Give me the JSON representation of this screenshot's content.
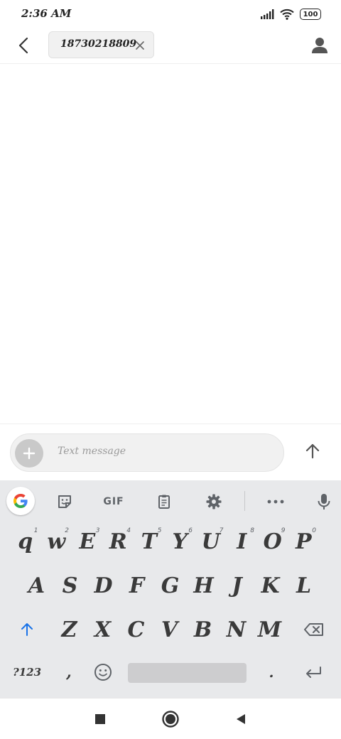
{
  "status_bar": {
    "time": "2:36 AM",
    "battery": "100",
    "icons": [
      "signal-icon",
      "wifi-icon",
      "battery-icon"
    ]
  },
  "header": {
    "back_icon": "chevron-left-icon",
    "recipient": "18730218809",
    "chip_close_icon": "close-icon",
    "contact_icon": "person-icon"
  },
  "compose": {
    "attach_icon": "plus-icon",
    "placeholder": "Text message",
    "send_icon": "arrow-up-icon"
  },
  "keyboard": {
    "toolbar": {
      "google_icon": "google-g-icon",
      "sticker_icon": "sticker-icon",
      "gif_label": "GIF",
      "clipboard_icon": "clipboard-icon",
      "settings_icon": "gear-icon",
      "more_icon": "more-icon",
      "mic_icon": "microphone-icon"
    },
    "rows": [
      [
        {
          "letter": "q",
          "hint": "1"
        },
        {
          "letter": "w",
          "hint": "2"
        },
        {
          "letter": "E",
          "hint": "3"
        },
        {
          "letter": "R",
          "hint": "4"
        },
        {
          "letter": "T",
          "hint": "5"
        },
        {
          "letter": "Y",
          "hint": "6"
        },
        {
          "letter": "U",
          "hint": "7"
        },
        {
          "letter": "I",
          "hint": "8"
        },
        {
          "letter": "O",
          "hint": "9"
        },
        {
          "letter": "P",
          "hint": "0"
        }
      ],
      [
        {
          "letter": "A"
        },
        {
          "letter": "S"
        },
        {
          "letter": "D"
        },
        {
          "letter": "F"
        },
        {
          "letter": "G"
        },
        {
          "letter": "H"
        },
        {
          "letter": "J"
        },
        {
          "letter": "K"
        },
        {
          "letter": "L"
        }
      ],
      [
        {
          "letter": "Z"
        },
        {
          "letter": "X"
        },
        {
          "letter": "C"
        },
        {
          "letter": "V"
        },
        {
          "letter": "B"
        },
        {
          "letter": "N"
        },
        {
          "letter": "M"
        }
      ]
    ],
    "shift_icon": "shift-arrow-icon",
    "backspace_icon": "backspace-icon",
    "symbols_label": "?123",
    "comma_label": ",",
    "emoji_icon": "emoji-icon",
    "period_label": ".",
    "enter_icon": "enter-icon"
  },
  "nav_bar": {
    "recents_icon": "square-icon",
    "home_icon": "home-circle-icon",
    "back_icon": "back-triangle-icon"
  }
}
